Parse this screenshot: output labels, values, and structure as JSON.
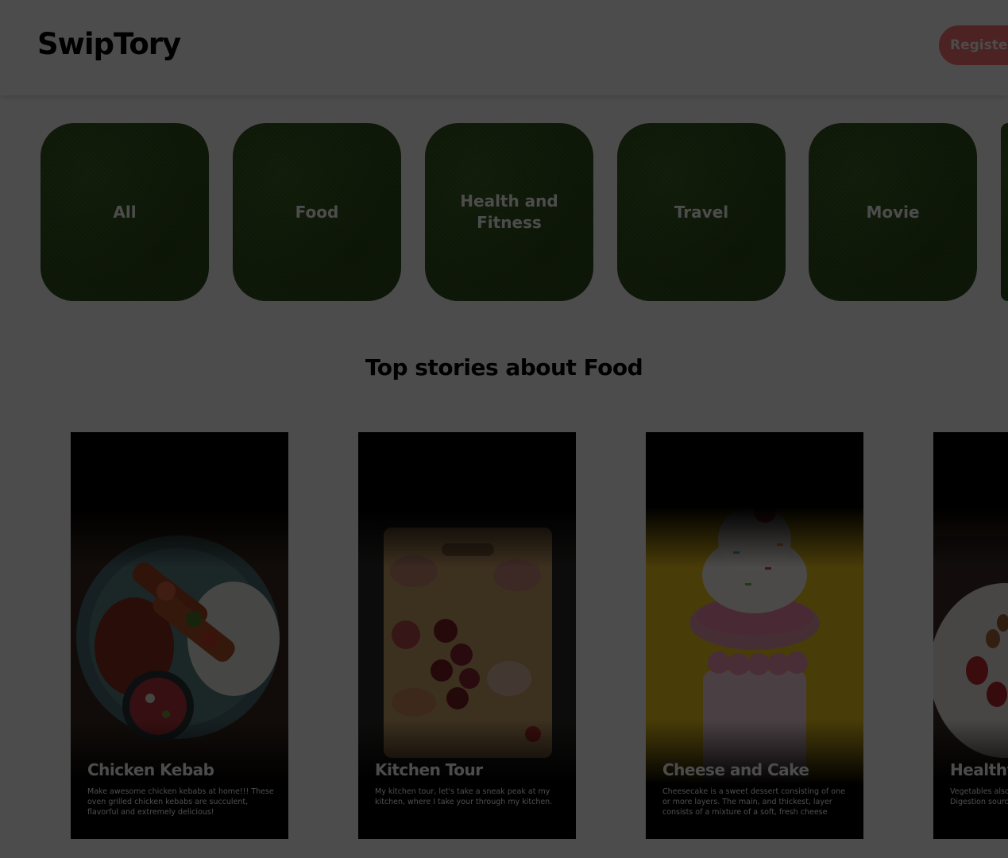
{
  "app": {
    "title": "SwipTory"
  },
  "navbar": {
    "register_label": "Register Now"
  },
  "categories": [
    {
      "label": "All"
    },
    {
      "label": "Food"
    },
    {
      "label": "Health and Fitness"
    },
    {
      "label": "Travel"
    },
    {
      "label": "Movie"
    },
    {
      "label": ""
    }
  ],
  "section": {
    "title": "Top stories about Food"
  },
  "stories": [
    {
      "title": "Chicken Kebab",
      "description": "Make awesome chicken kebabs at home!!! These oven grilled chicken kebabs are succulent, flavorful and extremely delicious!",
      "image_icon": "kebab-plate-image"
    },
    {
      "title": "Kitchen Tour",
      "description": "My kitchen tour, let's take a sneak peak at my kitchen, where I take your through my kitchen.",
      "image_icon": "charcuterie-board-image"
    },
    {
      "title": "Cheese and Cake",
      "description": "Cheesecake is a sweet dessert consisting of one or more layers. The main, and thickest, layer consists of a mixture of a soft, fresh cheese",
      "image_icon": "dessert-shake-image"
    },
    {
      "title": "Healthy",
      "description": "Vegetables also improved Digestion source of dietary",
      "image_icon": "fruits-nuts-image"
    }
  ],
  "colors": {
    "accent": "#ff7373",
    "category_bg": "#2f4d1c",
    "overlay": "rgba(0,0,0,0.7)"
  }
}
